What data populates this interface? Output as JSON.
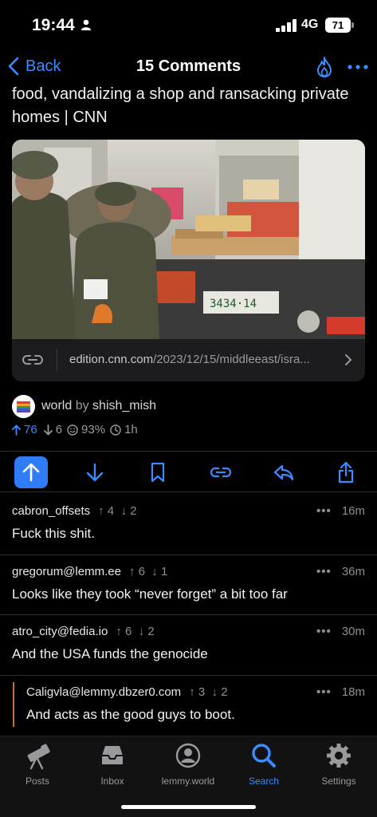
{
  "status": {
    "time": "19:44",
    "network": "4G",
    "battery": "71"
  },
  "nav": {
    "back_label": "Back",
    "title": "15 Comments"
  },
  "post": {
    "title": "food, vandalizing a shop and ransacking private homes | CNN",
    "link_host": "edition.cnn.com",
    "link_path": "/2023/12/15/middleeast/isra...",
    "community": "world",
    "by_label": "by",
    "author": "shish_mish",
    "upvotes": "76",
    "downvotes": "6",
    "ratio": "93%",
    "age": "1h"
  },
  "comments": [
    {
      "author": "cabron_offsets",
      "up": "4",
      "down": "2",
      "age": "16m",
      "text": "Fuck this shit."
    },
    {
      "author": "gregorum@lemm.ee",
      "up": "6",
      "down": "1",
      "age": "36m",
      "text": "Looks like they took “never forget” a bit too far"
    },
    {
      "author": "atro_city@fedia.io",
      "up": "6",
      "down": "2",
      "age": "30m",
      "text": "And the USA funds the genocide"
    },
    {
      "author": "Caligvla@lemmy.dbzer0.com",
      "up": "3",
      "down": "2",
      "age": "18m",
      "text": "And acts as the good guys to boot."
    }
  ],
  "more_symbol": "•••",
  "tabs": [
    {
      "label": "Posts",
      "icon": "telescope-icon"
    },
    {
      "label": "Inbox",
      "icon": "inbox-tray-icon"
    },
    {
      "label": "lemmy.world",
      "icon": "profile-icon"
    },
    {
      "label": "Search",
      "icon": "search-icon",
      "active": true
    },
    {
      "label": "Settings",
      "icon": "gear-icon"
    }
  ],
  "colors": {
    "accent": "#3a8cff",
    "background": "#000000",
    "thread_rail": "#c2703a"
  }
}
